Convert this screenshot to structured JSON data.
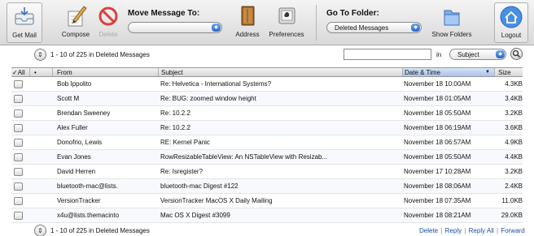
{
  "toolbar": {
    "get_mail": "Get Mail",
    "compose": "Compose",
    "delete": "Delete",
    "move_title": "Move Message To:",
    "move_value": "",
    "address": "Address",
    "preferences": "Preferences",
    "goto_title": "Go To Folder:",
    "goto_value": "Deleted Messages",
    "show_folders": "Show Folders",
    "logout": "Logout"
  },
  "pager": {
    "top_text": "1 - 10 of 225 in Deleted Messages",
    "bottom_text": "1 - 10 of 225 in Deleted Messages"
  },
  "search": {
    "value": "",
    "in_label": "in",
    "scope": "Subject"
  },
  "table": {
    "headers": {
      "check": "✓All",
      "flag": "•",
      "from": "From",
      "subject": "Subject",
      "date": "Date & Time",
      "size": "Size"
    },
    "rows": [
      {
        "from": "Bob Ippolito",
        "subject": "Re: Helvetica - International Systems?",
        "date": "November 18 10:00AM",
        "size": "4.3KB"
      },
      {
        "from": "Scott M",
        "subject": "Re: BUG: zoomed window height",
        "date": "November 18 01:05AM",
        "size": "3.4KB"
      },
      {
        "from": "Brendan Sweeney",
        "subject": "Re: 10.2.2",
        "date": "November 18 05:50AM",
        "size": "3.2KB"
      },
      {
        "from": "Alex Fuller",
        "subject": "Re: 10.2.2",
        "date": "November 18 06:19AM",
        "size": "3.6KB"
      },
      {
        "from": "Donofrio, Lewis",
        "subject": "RE: Kernel Panic",
        "date": "November 18 06:57AM",
        "size": "4.9KB"
      },
      {
        "from": "Evan Jones",
        "subject": "RowResizableTableView: An NSTableView with Resizab...",
        "date": "November 18 05:50AM",
        "size": "4.4KB"
      },
      {
        "from": "David Herren",
        "subject": "Re: Isregister?",
        "date": "November 17 10:28AM",
        "size": "3.2KB"
      },
      {
        "from": "bluetooth-mac@lists.",
        "subject": "bluetooth-mac Digest #122",
        "date": "November 18 08:06AM",
        "size": "2.4KB"
      },
      {
        "from": "VersionTracker",
        "subject": "VersionTracker MacOS X Daily Mailing",
        "date": "November 18 07:35AM",
        "size": "11.0KB"
      },
      {
        "from": "x4u@lists.themacinto",
        "subject": "Mac OS X Digest #3099",
        "date": "November 18 08:21AM",
        "size": "29.0KB"
      }
    ]
  },
  "footer": {
    "delete": "Delete",
    "reply": "Reply",
    "reply_all": "Reply All",
    "forward": "Forward"
  },
  "icons": {
    "get_mail": "inbox-tray-icon",
    "compose": "pencil-paper-icon",
    "delete": "no-sign-icon",
    "address": "address-book-icon",
    "preferences": "preferences-icon",
    "show_folders": "folder-icon",
    "logout": "house-icon",
    "pager": "navigation-arrows-icon",
    "search": "magnifier-icon"
  },
  "colors": {
    "accent": "#2a66c8",
    "link": "#1a4fa0",
    "delete_red": "#d9413a"
  }
}
